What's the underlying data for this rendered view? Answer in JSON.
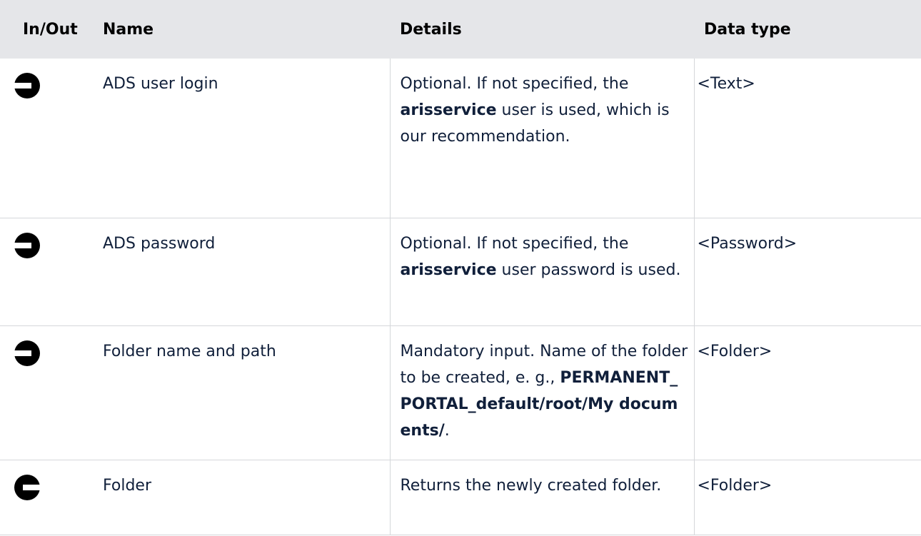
{
  "header": {
    "inout": "In/Out",
    "name": "Name",
    "details": "Details",
    "datatype": "Data type"
  },
  "rows": [
    {
      "direction": "in",
      "icon": "arrow-right-icon",
      "name": "ADS user login",
      "details": {
        "pre": "Optional. If not specified, the",
        "bold": "arisservice",
        "post": "user is used, which is our recommendation."
      },
      "datatype": "<Text>"
    },
    {
      "direction": "in",
      "icon": "arrow-right-icon",
      "name": "ADS password",
      "details": {
        "pre": "Optional. If not specified, the",
        "bold": "arisservice",
        "post": "user password is used."
      },
      "datatype": "<Password>"
    },
    {
      "direction": "in",
      "icon": "arrow-right-icon",
      "name": "Folder name and path",
      "details": {
        "pre": "Mandatory input. Name of the folder to be created, e. g.,",
        "bold": "PERMANENT_PORTAL_default/root/My documents/",
        "post": "."
      },
      "datatype": "<Folder>"
    },
    {
      "direction": "out",
      "icon": "arrow-left-icon",
      "name": "Folder",
      "details": {
        "pre": "Returns the newly created folder.",
        "bold": "",
        "post": ""
      },
      "datatype": "<Folder>"
    }
  ]
}
